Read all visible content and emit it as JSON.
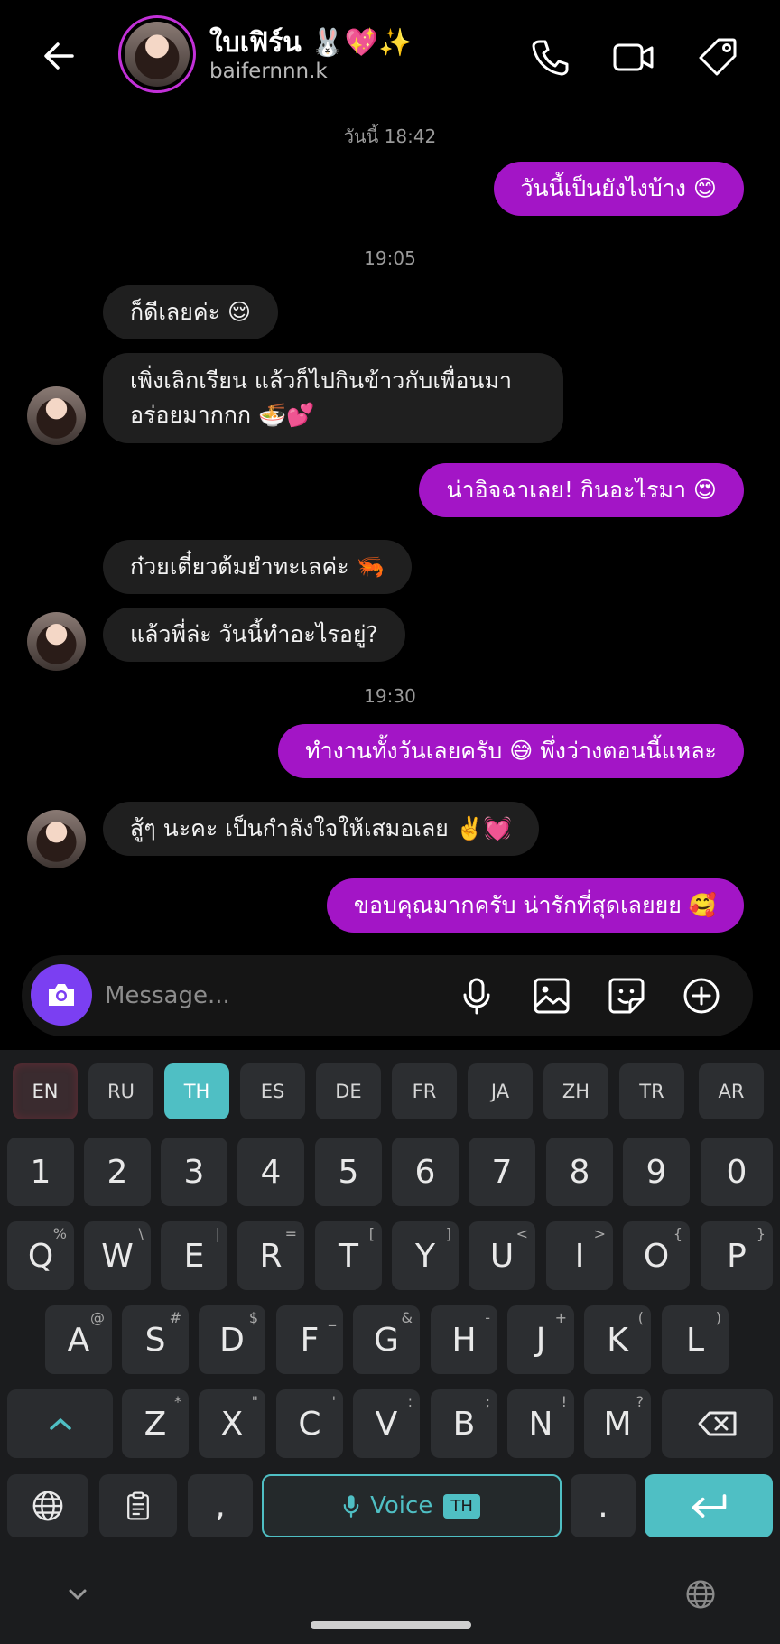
{
  "header": {
    "name": "ใบเฟิร์น 🐰💖✨",
    "handle": "baifernnn.k",
    "icons": [
      "back-arrow-icon",
      "phone-icon",
      "video-icon",
      "tag-icon"
    ]
  },
  "timestamps": [
    "วันนี้ 18:42",
    "19:05",
    "19:30"
  ],
  "messages": {
    "m1": "วันนี้เป็นยังไงบ้าง 😊",
    "m2": "ก็ดีเลยค่ะ 😌",
    "m3a": "เพิ่งเลิกเรียน แล้วก็ไปกินข้าวกับเพื่อนมา",
    "m3b": "อร่อยมากกก 🍜💕",
    "m4": "น่าอิจฉาเลย! กินอะไรมา 😍",
    "m5": "ก๋วยเตี๋ยวต้มยำทะเลค่ะ 🦐",
    "m6": "แล้วพี่ล่ะ วันนี้ทำอะไรอยู่?",
    "m7": "ทำงานทั้งวันเลยครับ 😅 พึ่งว่างตอนนี้แหละ",
    "m8": "สู้ๆ นะคะ เป็นกำลังใจให้เสมอเลย ✌️💓",
    "m9": "ขอบคุณมากครับ น่ารักที่สุดเลยยย 🥰"
  },
  "composer": {
    "placeholder": "Message...",
    "value": ""
  },
  "keyboard": {
    "languages": [
      "EN",
      "RU",
      "TH",
      "ES",
      "DE",
      "FR",
      "JA",
      "ZH",
      "TR",
      "AR"
    ],
    "selected_language": "TH",
    "numbers": [
      "1",
      "2",
      "3",
      "4",
      "5",
      "6",
      "7",
      "8",
      "9",
      "0"
    ],
    "row1": [
      "Q",
      "W",
      "E",
      "R",
      "T",
      "Y",
      "U",
      "I",
      "O",
      "P"
    ],
    "row1_sub": [
      "%",
      "\\",
      "|",
      "=",
      "[",
      "]",
      "<",
      ">",
      "{",
      "}"
    ],
    "row2": [
      "A",
      "S",
      "D",
      "F",
      "G",
      "H",
      "J",
      "K",
      "L"
    ],
    "row2_sub": [
      "@",
      "#",
      "$",
      "_",
      "&",
      "-",
      "+",
      "(",
      ")"
    ],
    "row3": [
      "Z",
      "X",
      "C",
      "V",
      "B",
      "N",
      "M"
    ],
    "row3_sub": [
      "*",
      "\"",
      "'",
      ":",
      ";",
      "!",
      "?"
    ],
    "comma": ",",
    "period": ".",
    "voice_label": "Voice",
    "voice_lang": "TH"
  },
  "colors": {
    "outgoing_bubble": "#a315c6",
    "incoming_bubble": "#1f1f1f",
    "accent": "#4fbfc4",
    "camera": "#7b3ff2"
  }
}
